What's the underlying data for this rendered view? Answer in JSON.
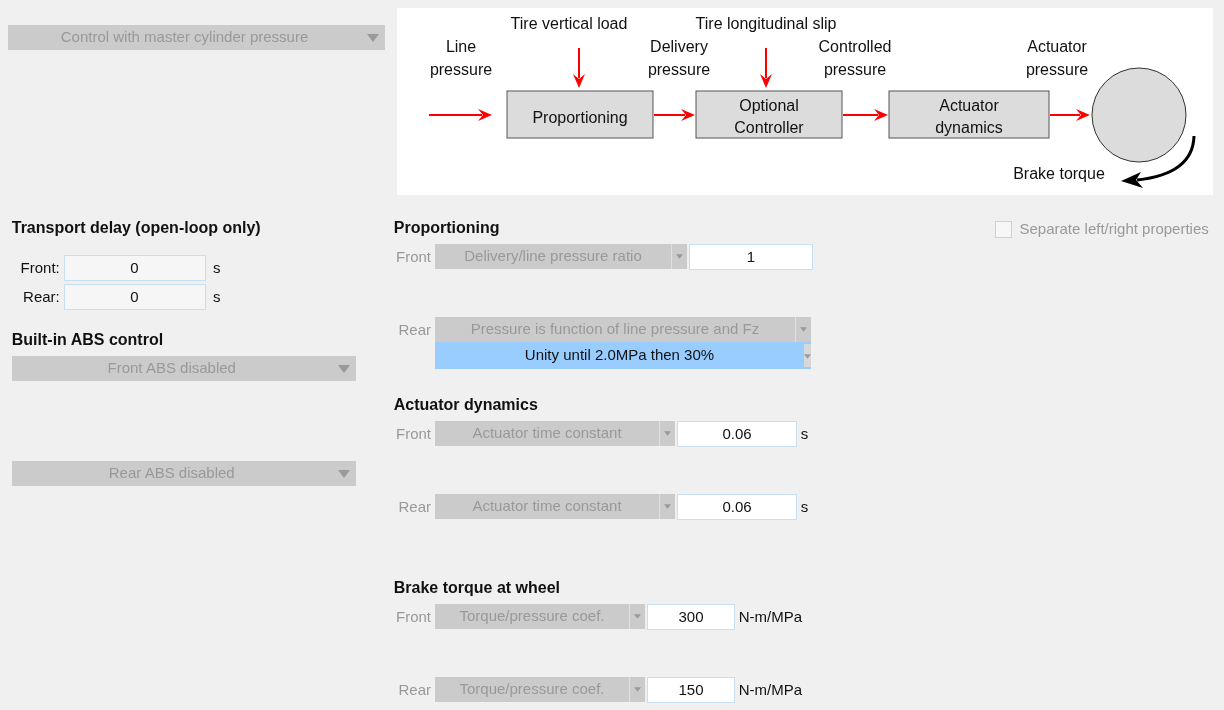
{
  "mode_dropdown": {
    "value": "Control with master cylinder pressure",
    "disabled": true
  },
  "diagram": {
    "labels": [
      "Line pressure",
      "Tire vertical load",
      "Delivery pressure",
      "Tire longitudinal slip",
      "Controlled pressure",
      "Actuator pressure",
      "Brake torque"
    ],
    "blocks": [
      "Proportioning",
      "Optional Controller",
      "Actuator dynamics"
    ]
  },
  "transport_delay": {
    "title": "Transport delay (open-loop only)",
    "rows": [
      {
        "label": "Front:",
        "value": "0",
        "unit": "s"
      },
      {
        "label": "Rear:",
        "value": "0",
        "unit": "s"
      }
    ]
  },
  "abs_control": {
    "title": "Built-in ABS control",
    "dropdowns": [
      {
        "value": "Front ABS disabled",
        "disabled": true
      },
      {
        "value": "Rear ABS disabled",
        "disabled": true
      }
    ]
  },
  "sections": [
    {
      "title": "Proportioning",
      "rows": [
        {
          "kind": "constant",
          "label": "Front",
          "dropdown": "Delivery/line pressure ratio",
          "value": "1"
        },
        {
          "kind": "table",
          "label": "Rear",
          "dropdown": "Pressure is function of line pressure and Fz",
          "table": "Unity until 2.0MPa then 30%"
        }
      ]
    },
    {
      "title": "Actuator dynamics",
      "rows": [
        {
          "kind": "constant",
          "label": "Front",
          "dropdown": "Actuator time constant",
          "value": "0.06",
          "unit": "s"
        },
        {
          "kind": "constant",
          "label": "Rear",
          "dropdown": "Actuator time constant",
          "value": "0.06",
          "unit": "s"
        }
      ]
    },
    {
      "title": "Brake torque at wheel",
      "rows": [
        {
          "kind": "constant",
          "label": "Front",
          "dropdown": "Torque/pressure coef.",
          "value": "300",
          "unit": "N-m/MPa"
        },
        {
          "kind": "constant",
          "label": "Rear",
          "dropdown": "Torque/pressure coef.",
          "value": "150",
          "unit": "N-m/MPa"
        }
      ]
    }
  ],
  "separate_checkbox": {
    "label": "Separate left/right properties",
    "checked": false,
    "disabled": true
  }
}
